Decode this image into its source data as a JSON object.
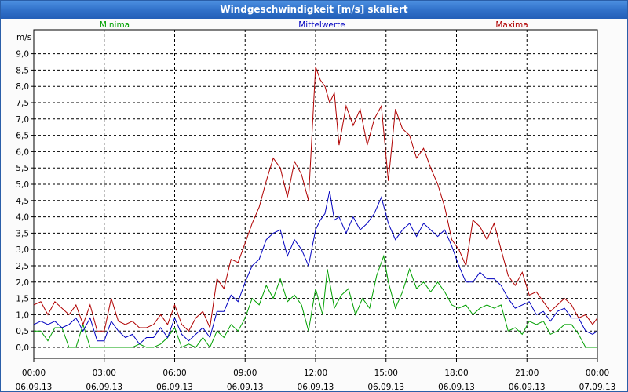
{
  "window": {
    "title": "Windgeschwindigkeit [m/s] skaliert"
  },
  "chart_data": {
    "type": "line",
    "title": "Windgeschwindigkeit [m/s] skaliert",
    "ylabel": "m/s",
    "ylim": [
      0,
      9.3
    ],
    "yticks": [
      "0,0",
      "0,5",
      "1,0",
      "1,5",
      "2,0",
      "2,5",
      "3,0",
      "3,5",
      "4,0",
      "4,5",
      "5,0",
      "5,5",
      "6,0",
      "6,5",
      "7,0",
      "7,5",
      "8,0",
      "8,5",
      "9,0"
    ],
    "xlim_hours": [
      0,
      24
    ],
    "xticks": [
      {
        "time": "00:00",
        "date": "06.09.13"
      },
      {
        "time": "03:00",
        "date": "06.09.13"
      },
      {
        "time": "06:00",
        "date": "06.09.13"
      },
      {
        "time": "09:00",
        "date": "06.09.13"
      },
      {
        "time": "12:00",
        "date": "06.09.13"
      },
      {
        "time": "15:00",
        "date": "06.09.13"
      },
      {
        "time": "18:00",
        "date": "06.09.13"
      },
      {
        "time": "21:00",
        "date": "06.09.13"
      },
      {
        "time": "00:00",
        "date": "07.09.13"
      }
    ],
    "grid": true,
    "legend_placement": "top",
    "series": [
      {
        "name": "Minima",
        "color": "#00a000",
        "values": [
          [
            0.0,
            0.5
          ],
          [
            0.3,
            0.5
          ],
          [
            0.6,
            0.2
          ],
          [
            0.9,
            0.6
          ],
          [
            1.2,
            0.6
          ],
          [
            1.5,
            0.0
          ],
          [
            1.8,
            0.0
          ],
          [
            2.1,
            0.7
          ],
          [
            2.4,
            0.0
          ],
          [
            2.7,
            0.0
          ],
          [
            3.0,
            0.0
          ],
          [
            3.3,
            0.0
          ],
          [
            3.6,
            0.0
          ],
          [
            3.9,
            0.0
          ],
          [
            4.2,
            0.0
          ],
          [
            4.5,
            0.1
          ],
          [
            4.8,
            0.0
          ],
          [
            5.1,
            0.0
          ],
          [
            5.4,
            0.1
          ],
          [
            5.7,
            0.3
          ],
          [
            6.0,
            0.6
          ],
          [
            6.3,
            0.0
          ],
          [
            6.6,
            0.1
          ],
          [
            6.9,
            0.0
          ],
          [
            7.2,
            0.3
          ],
          [
            7.5,
            0.0
          ],
          [
            7.8,
            0.5
          ],
          [
            8.1,
            0.3
          ],
          [
            8.4,
            0.7
          ],
          [
            8.7,
            0.5
          ],
          [
            9.0,
            0.9
          ],
          [
            9.3,
            1.5
          ],
          [
            9.6,
            1.3
          ],
          [
            9.9,
            1.9
          ],
          [
            10.2,
            1.5
          ],
          [
            10.5,
            2.1
          ],
          [
            10.8,
            1.4
          ],
          [
            11.1,
            1.6
          ],
          [
            11.4,
            1.3
          ],
          [
            11.7,
            0.5
          ],
          [
            12.0,
            1.8
          ],
          [
            12.3,
            1.0
          ],
          [
            12.5,
            2.4
          ],
          [
            12.8,
            1.2
          ],
          [
            13.1,
            1.6
          ],
          [
            13.4,
            1.8
          ],
          [
            13.7,
            1.0
          ],
          [
            14.0,
            1.5
          ],
          [
            14.3,
            1.2
          ],
          [
            14.6,
            2.2
          ],
          [
            14.9,
            2.8
          ],
          [
            15.1,
            2.0
          ],
          [
            15.4,
            1.2
          ],
          [
            15.7,
            1.7
          ],
          [
            16.0,
            2.4
          ],
          [
            16.3,
            1.8
          ],
          [
            16.6,
            2.0
          ],
          [
            16.9,
            1.7
          ],
          [
            17.2,
            2.0
          ],
          [
            17.5,
            1.7
          ],
          [
            17.8,
            1.3
          ],
          [
            18.1,
            1.2
          ],
          [
            18.4,
            1.3
          ],
          [
            18.7,
            1.0
          ],
          [
            19.0,
            1.2
          ],
          [
            19.3,
            1.3
          ],
          [
            19.6,
            1.2
          ],
          [
            19.9,
            1.3
          ],
          [
            20.2,
            0.5
          ],
          [
            20.5,
            0.6
          ],
          [
            20.8,
            0.4
          ],
          [
            21.1,
            0.8
          ],
          [
            21.4,
            0.7
          ],
          [
            21.7,
            0.8
          ],
          [
            22.0,
            0.4
          ],
          [
            22.3,
            0.5
          ],
          [
            22.6,
            0.7
          ],
          [
            22.9,
            0.7
          ],
          [
            23.2,
            0.4
          ],
          [
            23.5,
            0.0
          ],
          [
            23.8,
            0.0
          ],
          [
            24.0,
            0.0
          ]
        ]
      },
      {
        "name": "Mittelwerte",
        "color": "#0000c0",
        "values": [
          [
            0.0,
            0.7
          ],
          [
            0.3,
            0.8
          ],
          [
            0.6,
            0.7
          ],
          [
            0.9,
            0.8
          ],
          [
            1.2,
            0.6
          ],
          [
            1.5,
            0.7
          ],
          [
            1.8,
            0.9
          ],
          [
            2.1,
            0.5
          ],
          [
            2.4,
            0.9
          ],
          [
            2.7,
            0.2
          ],
          [
            3.0,
            0.2
          ],
          [
            3.3,
            0.8
          ],
          [
            3.6,
            0.5
          ],
          [
            3.9,
            0.3
          ],
          [
            4.2,
            0.4
          ],
          [
            4.5,
            0.1
          ],
          [
            4.8,
            0.3
          ],
          [
            5.1,
            0.3
          ],
          [
            5.4,
            0.6
          ],
          [
            5.7,
            0.3
          ],
          [
            6.0,
            0.9
          ],
          [
            6.3,
            0.4
          ],
          [
            6.6,
            0.2
          ],
          [
            6.9,
            0.4
          ],
          [
            7.2,
            0.6
          ],
          [
            7.5,
            0.3
          ],
          [
            7.8,
            1.1
          ],
          [
            8.1,
            1.1
          ],
          [
            8.4,
            1.6
          ],
          [
            8.7,
            1.4
          ],
          [
            9.0,
            2.0
          ],
          [
            9.3,
            2.5
          ],
          [
            9.6,
            2.7
          ],
          [
            9.9,
            3.3
          ],
          [
            10.2,
            3.5
          ],
          [
            10.5,
            3.6
          ],
          [
            10.8,
            2.8
          ],
          [
            11.1,
            3.3
          ],
          [
            11.4,
            3.0
          ],
          [
            11.7,
            2.5
          ],
          [
            12.0,
            3.6
          ],
          [
            12.2,
            3.9
          ],
          [
            12.4,
            4.1
          ],
          [
            12.6,
            4.8
          ],
          [
            12.8,
            3.9
          ],
          [
            13.0,
            4.0
          ],
          [
            13.3,
            3.5
          ],
          [
            13.6,
            4.0
          ],
          [
            13.9,
            3.6
          ],
          [
            14.2,
            3.8
          ],
          [
            14.5,
            4.1
          ],
          [
            14.8,
            4.6
          ],
          [
            15.1,
            3.8
          ],
          [
            15.4,
            3.3
          ],
          [
            15.7,
            3.6
          ],
          [
            16.0,
            3.8
          ],
          [
            16.3,
            3.4
          ],
          [
            16.6,
            3.8
          ],
          [
            16.9,
            3.6
          ],
          [
            17.2,
            3.4
          ],
          [
            17.5,
            3.6
          ],
          [
            17.8,
            3.1
          ],
          [
            18.1,
            2.5
          ],
          [
            18.4,
            2.0
          ],
          [
            18.7,
            2.0
          ],
          [
            19.0,
            2.3
          ],
          [
            19.3,
            2.1
          ],
          [
            19.6,
            2.1
          ],
          [
            19.9,
            1.9
          ],
          [
            20.2,
            1.5
          ],
          [
            20.5,
            1.2
          ],
          [
            20.8,
            1.3
          ],
          [
            21.1,
            1.4
          ],
          [
            21.4,
            1.0
          ],
          [
            21.7,
            1.1
          ],
          [
            22.0,
            0.8
          ],
          [
            22.3,
            1.1
          ],
          [
            22.6,
            1.2
          ],
          [
            22.9,
            0.9
          ],
          [
            23.2,
            0.9
          ],
          [
            23.5,
            0.5
          ],
          [
            23.8,
            0.4
          ],
          [
            24.0,
            0.5
          ]
        ]
      },
      {
        "name": "Maxima",
        "color": "#b00000",
        "values": [
          [
            0.0,
            1.3
          ],
          [
            0.3,
            1.4
          ],
          [
            0.6,
            1.0
          ],
          [
            0.9,
            1.4
          ],
          [
            1.2,
            1.2
          ],
          [
            1.5,
            1.0
          ],
          [
            1.8,
            1.3
          ],
          [
            2.1,
            0.7
          ],
          [
            2.4,
            1.3
          ],
          [
            2.7,
            0.5
          ],
          [
            3.0,
            0.5
          ],
          [
            3.3,
            1.5
          ],
          [
            3.6,
            0.8
          ],
          [
            3.9,
            0.7
          ],
          [
            4.2,
            0.8
          ],
          [
            4.5,
            0.6
          ],
          [
            4.8,
            0.6
          ],
          [
            5.1,
            0.7
          ],
          [
            5.4,
            1.0
          ],
          [
            5.7,
            0.7
          ],
          [
            6.0,
            1.3
          ],
          [
            6.3,
            0.7
          ],
          [
            6.6,
            0.5
          ],
          [
            6.9,
            0.9
          ],
          [
            7.2,
            1.1
          ],
          [
            7.5,
            0.6
          ],
          [
            7.8,
            2.1
          ],
          [
            8.1,
            1.8
          ],
          [
            8.4,
            2.7
          ],
          [
            8.7,
            2.6
          ],
          [
            9.0,
            3.2
          ],
          [
            9.3,
            3.8
          ],
          [
            9.6,
            4.3
          ],
          [
            9.9,
            5.1
          ],
          [
            10.2,
            5.8
          ],
          [
            10.5,
            5.5
          ],
          [
            10.8,
            4.6
          ],
          [
            11.1,
            5.7
          ],
          [
            11.4,
            5.3
          ],
          [
            11.7,
            4.5
          ],
          [
            12.0,
            8.6
          ],
          [
            12.2,
            8.2
          ],
          [
            12.4,
            8.0
          ],
          [
            12.6,
            7.5
          ],
          [
            12.8,
            7.8
          ],
          [
            13.0,
            6.2
          ],
          [
            13.3,
            7.4
          ],
          [
            13.6,
            6.8
          ],
          [
            13.9,
            7.3
          ],
          [
            14.2,
            6.2
          ],
          [
            14.5,
            7.0
          ],
          [
            14.8,
            7.4
          ],
          [
            15.1,
            5.1
          ],
          [
            15.4,
            7.3
          ],
          [
            15.7,
            6.7
          ],
          [
            16.0,
            6.5
          ],
          [
            16.3,
            5.8
          ],
          [
            16.6,
            6.1
          ],
          [
            16.9,
            5.5
          ],
          [
            17.2,
            5.0
          ],
          [
            17.5,
            4.3
          ],
          [
            17.8,
            3.3
          ],
          [
            18.1,
            3.0
          ],
          [
            18.4,
            2.5
          ],
          [
            18.7,
            3.9
          ],
          [
            19.0,
            3.7
          ],
          [
            19.3,
            3.3
          ],
          [
            19.6,
            3.8
          ],
          [
            19.9,
            3.0
          ],
          [
            20.2,
            2.2
          ],
          [
            20.5,
            1.9
          ],
          [
            20.8,
            2.3
          ],
          [
            21.1,
            1.6
          ],
          [
            21.4,
            1.7
          ],
          [
            21.7,
            1.4
          ],
          [
            22.0,
            1.1
          ],
          [
            22.3,
            1.3
          ],
          [
            22.6,
            1.5
          ],
          [
            22.9,
            1.3
          ],
          [
            23.2,
            0.9
          ],
          [
            23.5,
            1.0
          ],
          [
            23.8,
            0.7
          ],
          [
            24.0,
            0.9
          ]
        ]
      }
    ]
  }
}
